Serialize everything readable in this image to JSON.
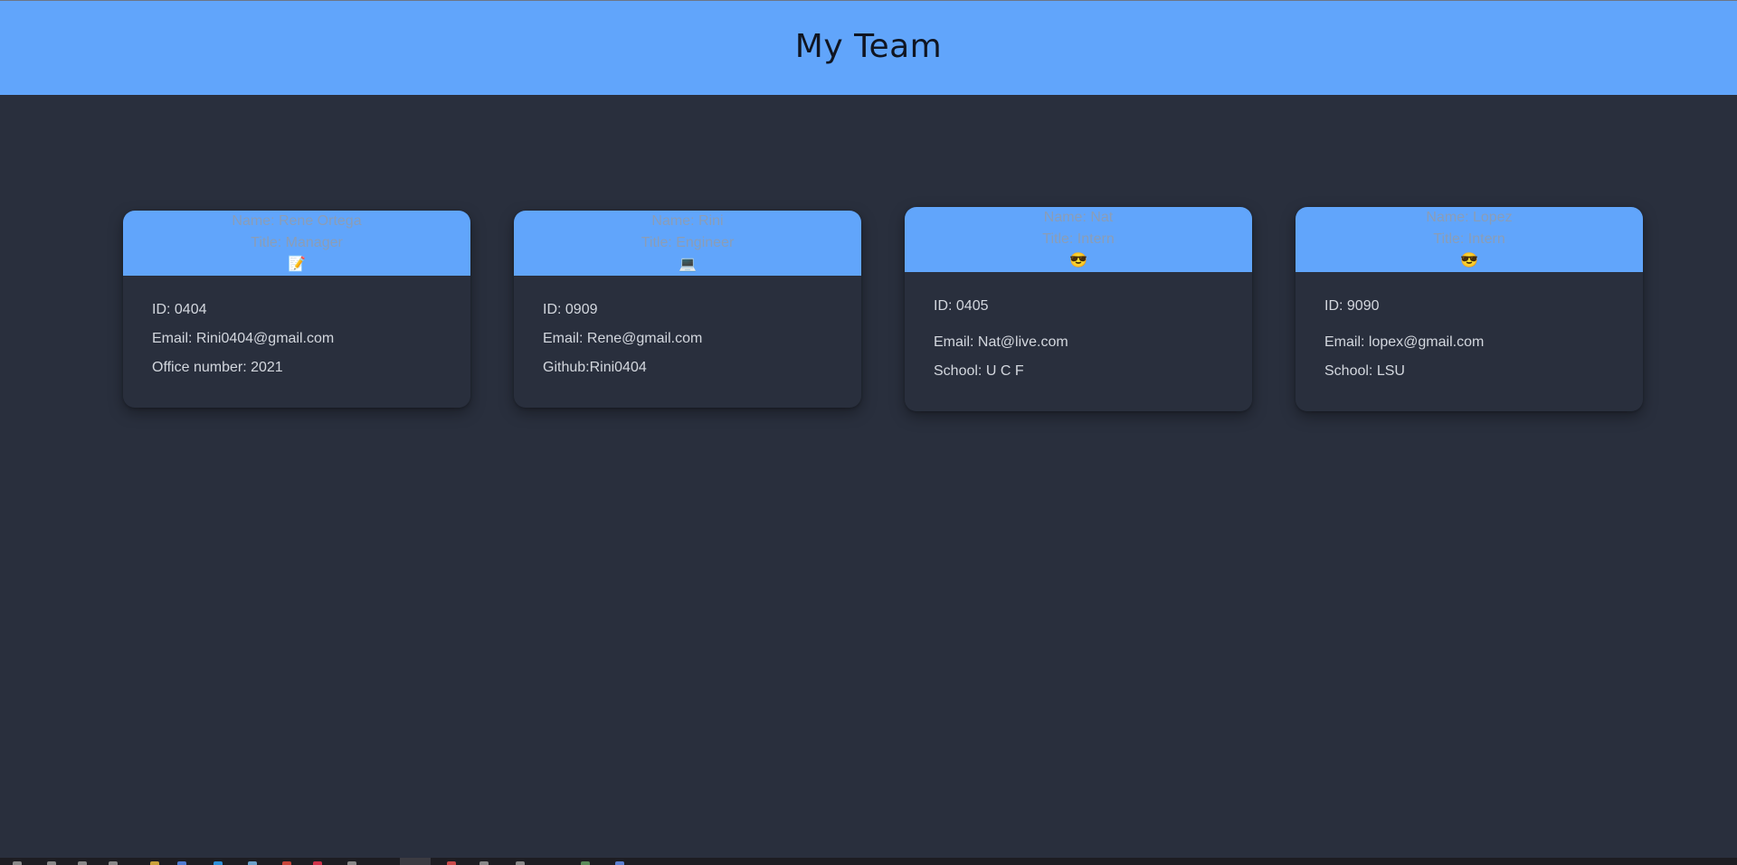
{
  "header": {
    "title": "My Team"
  },
  "cards": [
    {
      "name": "Name: Rene Ortega",
      "title": "Title: Manager",
      "icon": "📝",
      "icon_name": "memo-icon",
      "details": [
        "ID: 0404",
        "Email: Rini0404@gmail.com",
        "Office number: 2021"
      ]
    },
    {
      "name": "Name: Rini",
      "title": "Title: Engineer",
      "icon": "💻",
      "icon_name": "laptop-icon",
      "details": [
        "ID: 0909",
        "Email: Rene@gmail.com",
        "Github:Rini0404"
      ]
    },
    {
      "name": "Name: Nat",
      "title": "Title: Intern",
      "icon": "😎",
      "icon_name": "sunglasses-face-icon",
      "details": [
        "ID: 0405",
        "Email: Nat@live.com",
        "School: U C F"
      ]
    },
    {
      "name": "Name: Lopez",
      "title": "Title: Intern",
      "icon": "😎",
      "icon_name": "sunglasses-face-icon",
      "details": [
        "ID: 9090",
        "Email: lopex@gmail.com",
        "School: LSU"
      ]
    }
  ],
  "colors": {
    "header_bg": "#61a5fb",
    "page_bg": "#292f3d",
    "title_text": "#101521",
    "card_head_text": "#8b9db6",
    "card_body_text": "#d3d7de"
  }
}
